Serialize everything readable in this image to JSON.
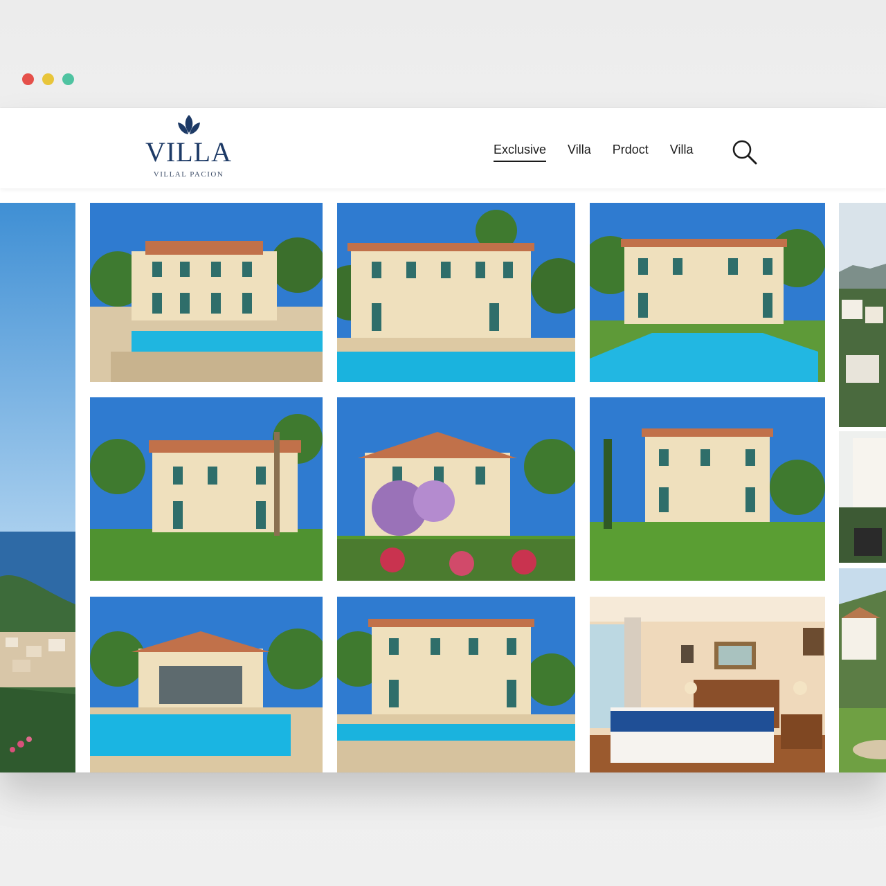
{
  "window": {
    "dot_colors": [
      "#e5504a",
      "#e8c53a",
      "#4fc3a1"
    ]
  },
  "brand": {
    "name": "VILLA",
    "tagline": "VILLAL PACION",
    "color": "#1d3a66"
  },
  "nav": {
    "items": [
      "Exclusive",
      "Villa",
      "Prdoct",
      "Villa"
    ],
    "active_index": 0
  },
  "search": {
    "icon": "search-icon"
  },
  "gallery": {
    "left_panel": "coastal-view-photo",
    "right_panel": "hillside-town-photo",
    "tiles": [
      "villa-pool-photo-1",
      "villa-pool-photo-2",
      "villa-pool-photo-3",
      "villa-garden-photo-1",
      "villa-garden-photo-2",
      "villa-garden-photo-3",
      "villa-pool-photo-4",
      "villa-pool-photo-5",
      "bedroom-photo"
    ]
  }
}
